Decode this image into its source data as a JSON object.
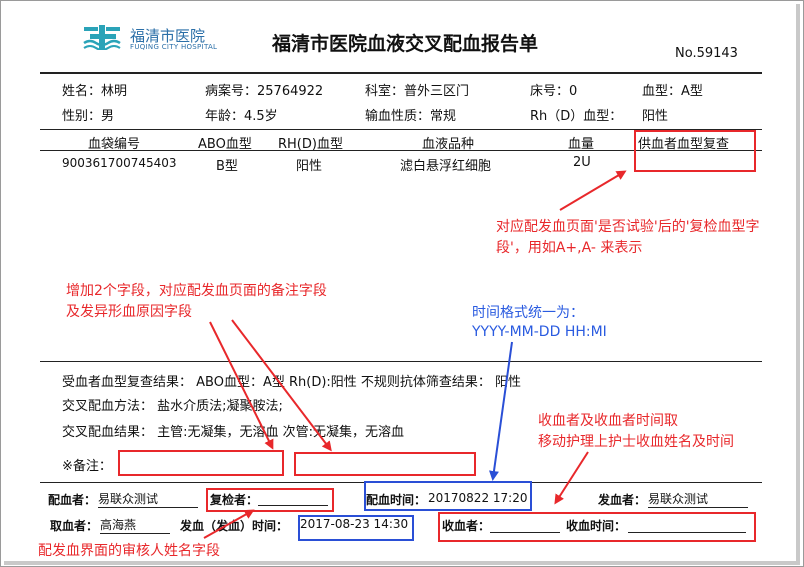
{
  "header": {
    "hospital_logo_cn": "福清市医院",
    "hospital_logo_en": "FUQING CITY HOSPITAL",
    "title": "福清市医院血液交叉配血报告单",
    "doc_no": "No.59143"
  },
  "patient": {
    "name": "姓名：林明",
    "record_no": "病案号：25764922",
    "dept": "科室：普外三区门",
    "bed": "床号：0",
    "blood_type": "血型：A型",
    "gender": "性别：男",
    "age": "年龄：4.5岁",
    "transfusion_type": "输血性质：常规",
    "rh_label": "Rh（D）血型：",
    "rh_value": "阳性"
  },
  "table": {
    "headers": [
      "血袋编号",
      "ABO血型",
      "RH(D)血型",
      "血液品种",
      "血量",
      "供血者血型复查"
    ],
    "rows": [
      [
        "900361700745403",
        "B型",
        "阳性",
        "滤白悬浮红细胞",
        "2U",
        ""
      ]
    ]
  },
  "results": {
    "recheck": "受血者血型复查结果：  ABO血型：A型  Rh(D):阳性    不规则抗体筛查结果：  阳性",
    "method": "交叉配血方法：    盐水介质法;凝聚胺法;",
    "crossmatch": "交叉配血结果：     主管:无凝集，无溶血  次管:无凝集，无溶血",
    "remark": "※备注："
  },
  "footer": {
    "matcher_label": "配血者：",
    "matcher_value": "易联众测试",
    "checker_label": "复检者：",
    "match_time_label": "配血时间：",
    "match_time_value": "20170822  17:20",
    "sender_label": "发血者：",
    "sender_value": "易联众测试",
    "taker_label": "取血者：",
    "taker_value": "高海燕",
    "send_time_label": "发血（发血）时间：",
    "send_time_value": "2017-08-23 14:30",
    "receiver_label": "收血者：",
    "receive_time_label": "收血时间："
  },
  "annotations": {
    "recheck_note_line1": "对应配发血页面'是否试验'后的'复检血型字",
    "recheck_note_line2": "段'，用如A+,A- 来表示",
    "remark_note_line1": "增加2个字段，对应配发血页面的备注字段",
    "remark_note_line2": "及发异形血原因字段",
    "time_note_line1": "时间格式统一为：",
    "time_note_line2": "YYYY-MM-DD HH:MI",
    "receiver_note_line1": "收血者及收血者时间取",
    "receiver_note_line2": "移动护理上护士收血姓名及时间",
    "checker_note": "配发血界面的审核人姓名字段"
  },
  "colors": {
    "annotation_red": "#e8282b",
    "annotation_blue": "#2a4fd6",
    "logo": "#2aa3b8"
  }
}
